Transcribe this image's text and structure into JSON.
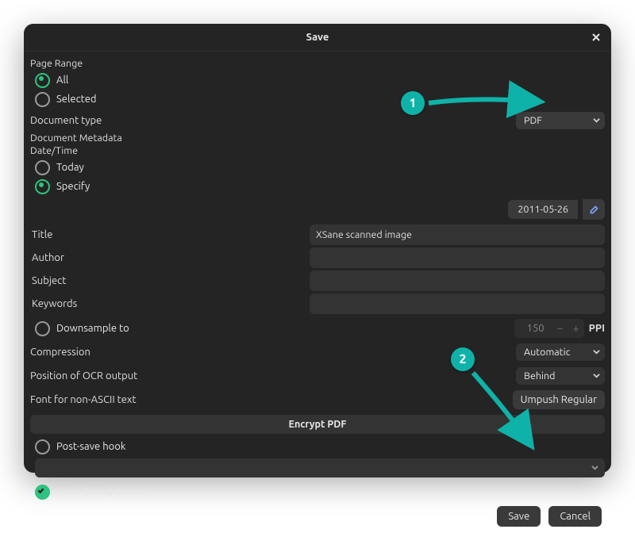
{
  "window": {
    "title": "Save"
  },
  "pageRange": {
    "heading": "Page Range",
    "all": "All",
    "selected": "Selected",
    "value": "all"
  },
  "docType": {
    "label": "Document type",
    "value": "PDF"
  },
  "metadata": {
    "heading": "Document Metadata",
    "dateHeading": "Date/Time",
    "today": "Today",
    "specify": "Specify",
    "mode": "specify",
    "dateValue": "2011-05-26"
  },
  "fields": {
    "titleLabel": "Title",
    "titleValue": "XSane scanned image",
    "authorLabel": "Author",
    "authorValue": "",
    "subjectLabel": "Subject",
    "subjectValue": "",
    "keywordsLabel": "Keywords",
    "keywordsValue": ""
  },
  "downsample": {
    "label": "Downsample to",
    "checked": false,
    "value": "150",
    "unit": "PPI"
  },
  "compression": {
    "label": "Compression",
    "value": "Automatic"
  },
  "ocrPos": {
    "label": "Position of OCR output",
    "value": "Behind"
  },
  "font": {
    "label": "Font for non-ASCII text",
    "value": "Umpush Regular"
  },
  "encrypt": {
    "label": "Encrypt PDF"
  },
  "postSave": {
    "label": "Post-save hook",
    "checked": false
  },
  "closeDialog": {
    "label": "Close dialog on save",
    "checked": true
  },
  "buttons": {
    "save": "Save",
    "cancel": "Cancel"
  },
  "annotations": {
    "step1": "1",
    "step2": "2"
  },
  "colors": {
    "accent": "#0fb2a8",
    "radioOn": "#2ec27e"
  }
}
